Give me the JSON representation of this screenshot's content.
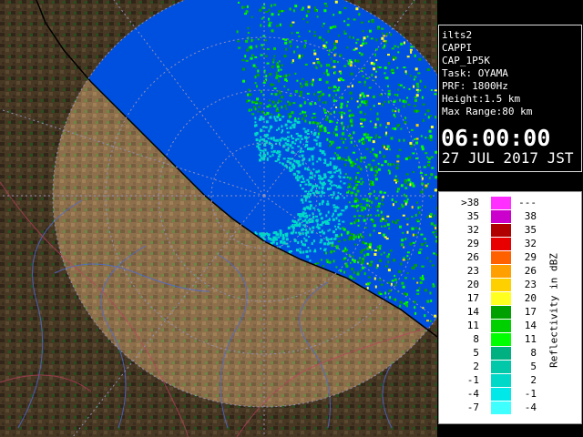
{
  "info": {
    "station": "ilts2",
    "product": "CAPPI",
    "code": "CAP_1P5K",
    "task": "Task: OYAMA",
    "prf": "PRF: 1800Hz",
    "height": "Height:1.5 km",
    "range": "Max Range:80 km",
    "time": "06:00:00",
    "date": "27 JUL 2017 JST"
  },
  "legend": {
    "unit": "Reflectivity in dBZ",
    "rows": [
      {
        "lo": ">38",
        "hi": "---",
        "color": "#ff30ff"
      },
      {
        "lo": "35",
        "hi": "38",
        "color": "#cc00cc"
      },
      {
        "lo": "32",
        "hi": "35",
        "color": "#b00000"
      },
      {
        "lo": "29",
        "hi": "32",
        "color": "#e80000"
      },
      {
        "lo": "26",
        "hi": "29",
        "color": "#ff6000"
      },
      {
        "lo": "23",
        "hi": "26",
        "color": "#ffa000"
      },
      {
        "lo": "20",
        "hi": "23",
        "color": "#ffd000"
      },
      {
        "lo": "17",
        "hi": "20",
        "color": "#ffff20"
      },
      {
        "lo": "14",
        "hi": "17",
        "color": "#00a000"
      },
      {
        "lo": "11",
        "hi": "14",
        "color": "#00d000"
      },
      {
        "lo": "8",
        "hi": "11",
        "color": "#00ff00"
      },
      {
        "lo": "5",
        "hi": "8",
        "color": "#00b080"
      },
      {
        "lo": "2",
        "hi": "5",
        "color": "#00c8a8"
      },
      {
        "lo": "-1",
        "hi": "2",
        "color": "#00d8c8"
      },
      {
        "lo": "-4",
        "hi": "-1",
        "color": "#00e8e8"
      },
      {
        "lo": "-7",
        "hi": "-4",
        "color": "#40ffff"
      }
    ]
  },
  "map": {
    "sea_color": "#0050e0",
    "land_color": "#6e5638",
    "range_ring_color": "#8888aa",
    "echo_colors": [
      "#00d8c8",
      "#00ff00",
      "#00d000",
      "#00a000",
      "#ffff20",
      "#ffd000"
    ]
  }
}
